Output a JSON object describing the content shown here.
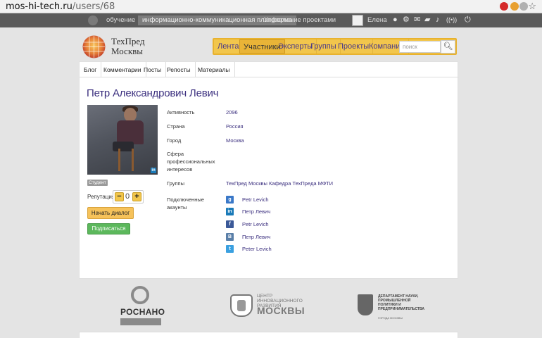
{
  "browser": {
    "url_host": "mos-hi-tech.ru",
    "url_path": "/users/68"
  },
  "topnav": {
    "items": [
      "обучение",
      "информационно-коммуникационная платформа",
      "Управление проектами"
    ],
    "user_name": "Елена",
    "icons": [
      "plus-icon",
      "gear-icon",
      "mail-icon",
      "chat-icon",
      "bell-icon",
      "broadcast-icon",
      "power-icon"
    ]
  },
  "brand": {
    "line1": "ТехПред",
    "line2": "Москвы"
  },
  "mainnav": {
    "items": [
      "Лента",
      "Участники",
      "Эксперты",
      "Группы",
      "Проекты",
      "Компании"
    ],
    "active": "Участники",
    "search_placeholder": "поиск"
  },
  "tabs": [
    "Блог",
    "Комментарии",
    "Посты",
    "Репосты",
    "Материалы"
  ],
  "profile": {
    "name": "Петр Александрович Левич",
    "badge": "Студент",
    "reputation_label": "Репутация",
    "reputation_value": "0",
    "dialog_button": "Начать диалог",
    "subscribe_button": "Подписаться",
    "fields": {
      "activity_label": "Активность",
      "activity_value": "2096",
      "country_label": "Страна",
      "country_value": "Россия",
      "city_label": "Город",
      "city_value": "Москва",
      "interests_label": "Сфера профессиональных интересов",
      "groups_label": "Группы",
      "groups_value": "ТехПред Москвы Кафедра ТехПреда МФТИ",
      "accounts_label": "Подключенные акаунты"
    },
    "accounts": [
      {
        "service": "google",
        "icon": "google-icon",
        "label": "Petr Levich",
        "color": "#3a78c8"
      },
      {
        "service": "linkedin",
        "icon": "linkedin-icon",
        "label": "Петр Левич",
        "color": "#1a7ab8"
      },
      {
        "service": "facebook",
        "icon": "facebook-icon",
        "label": "Petr Levich",
        "color": "#3b5998"
      },
      {
        "service": "vkontakte",
        "icon": "vk-icon",
        "label": "Петр Левич",
        "color": "#5a7fa8"
      },
      {
        "service": "twitter",
        "icon": "twitter-icon",
        "label": "Peter Levich",
        "color": "#3aa0e0"
      }
    ]
  },
  "footer": {
    "rosnano": "РОСНАНО",
    "cir_small": "ЦЕНТР\nИННОВАЦИОННОГО\nРАЗВИТИЯ",
    "cir_big": "МОСКВЫ",
    "dept": "ДЕПАРТАМЕНТ НАУКИ,\nПРОМЫШЛЕННОЙ\nПОЛИТИКИ И\nПРЕДПРИНИМАТЕЛЬСТВА",
    "dept_sub": "ГОРОДА МОСКВЫ"
  }
}
